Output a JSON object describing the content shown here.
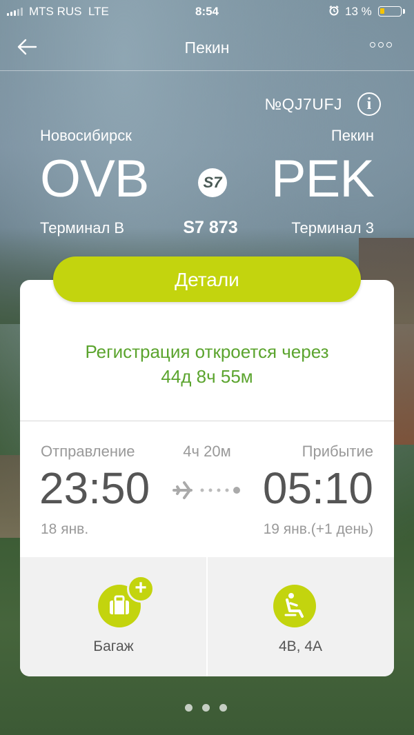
{
  "status_bar": {
    "carrier": "MTS RUS",
    "network": "LTE",
    "time": "8:54",
    "battery_percent": "13 %",
    "battery_level": 0.13,
    "icons": [
      "signal-icon",
      "alarm-icon",
      "battery-icon"
    ]
  },
  "nav": {
    "title": "Пекин",
    "back_icon": "arrow-left-icon",
    "more_icon": "more-dots-icon"
  },
  "booking": {
    "number": "№QJ7UFJ",
    "info_icon": "i"
  },
  "route": {
    "origin": {
      "city": "Новосибирск",
      "code": "OVB",
      "terminal": "Терминал B"
    },
    "destination": {
      "city": "Пекин",
      "code": "PEK",
      "terminal": "Терминал 3"
    },
    "airline_logo": "S7",
    "flight_number": "S7 873"
  },
  "details_button": "Детали",
  "registration": {
    "line1": "Регистрация откроется через",
    "line2": "44д 8ч 55м"
  },
  "timeline": {
    "departure_label": "Отправление",
    "duration": "4ч 20м",
    "arrival_label": "Прибытие",
    "departure_time": "23:50",
    "arrival_time": "05:10",
    "departure_date": "18 янв.",
    "arrival_date": "19 янв.(+1 день)"
  },
  "tiles": [
    {
      "label": "Багаж",
      "icon": "baggage-icon",
      "badge": "+"
    },
    {
      "label": "4B, 4A",
      "icon": "seat-icon"
    }
  ],
  "pager": {
    "count": 3,
    "active": 0
  },
  "colors": {
    "accent": "#c3d40e",
    "registration_text": "#5ba42e",
    "muted_text": "#999999",
    "time_text": "#555555"
  }
}
